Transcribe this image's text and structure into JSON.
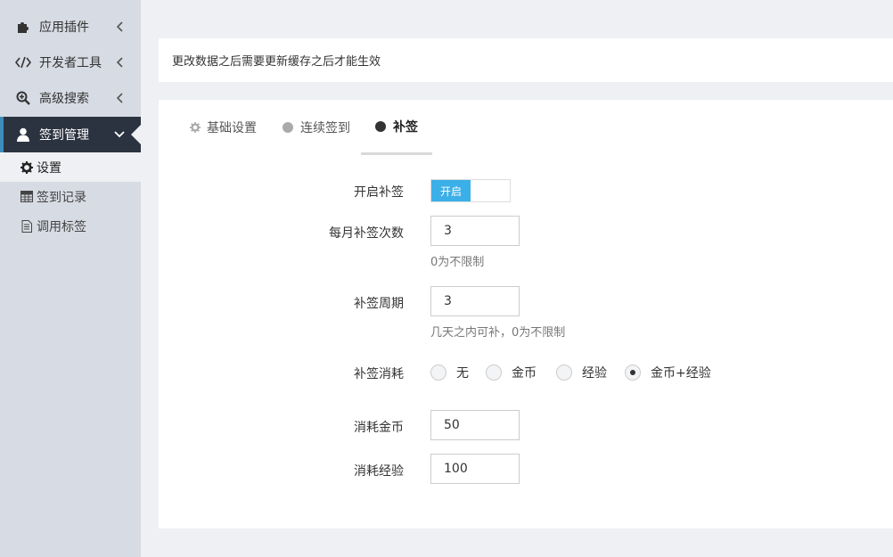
{
  "sidebar": {
    "items": [
      {
        "label": "应用插件",
        "icon": "puzzle-icon"
      },
      {
        "label": "开发者工具",
        "icon": "code-icon"
      },
      {
        "label": "高级搜索",
        "icon": "search-plus-icon"
      },
      {
        "label": "签到管理",
        "icon": "user-icon",
        "active": true
      }
    ],
    "subitems": [
      {
        "label": "设置",
        "icon": "gear-icon",
        "active": true
      },
      {
        "label": "签到记录",
        "icon": "table-icon"
      },
      {
        "label": "调用标签",
        "icon": "file-icon"
      }
    ]
  },
  "notice": "更改数据之后需要更新缓存之后才能生效",
  "tabs": [
    {
      "label": "基础设置",
      "icon": "gear-icon"
    },
    {
      "label": "连续签到",
      "icon": "circle-icon"
    },
    {
      "label": "补签",
      "icon": "circle-icon",
      "active": true
    }
  ],
  "form": {
    "enable": {
      "label": "开启补签",
      "switch_on": "开启"
    },
    "monthly_count": {
      "label": "每月补签次数",
      "value": "3",
      "help": "0为不限制"
    },
    "period": {
      "label": "补签周期",
      "value": "3",
      "help": "几天之内可补，0为不限制"
    },
    "cost": {
      "label": "补签消耗",
      "options": [
        "无",
        "金币",
        "经验",
        "金币+经验"
      ],
      "selected": "金币+经验"
    },
    "cost_gold": {
      "label": "消耗金币",
      "value": "50"
    },
    "cost_exp": {
      "label": "消耗经验",
      "value": "100"
    }
  },
  "colors": {
    "sidebar_bg": "#d7dbe3",
    "active_bg": "#2c3340",
    "accent": "#3c8dbc",
    "switch_on": "#3aafe8"
  }
}
